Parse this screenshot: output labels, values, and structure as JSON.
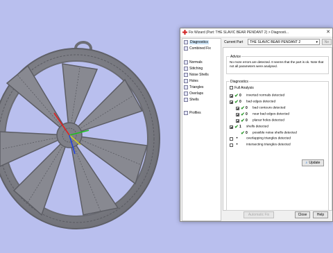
{
  "window": {
    "title": "Fix Wizard (Part: THE SLAVIC BEAR PENDANT 2) > Diagnosti...",
    "close_glyph": "✕"
  },
  "nav": {
    "items": [
      {
        "label": "Diagnostics",
        "icon": "magnifier-icon"
      },
      {
        "label": "Combined Fix",
        "icon": "combined-fix-icon"
      },
      {
        "label": "Normals",
        "icon": "normals-icon"
      },
      {
        "label": "Stitching",
        "icon": "stitching-icon"
      },
      {
        "label": "Noise Shells",
        "icon": "noise-shells-icon"
      },
      {
        "label": "Holes",
        "icon": "holes-icon"
      },
      {
        "label": "Triangles",
        "icon": "triangles-icon"
      },
      {
        "label": "Overlaps",
        "icon": "overlaps-icon"
      },
      {
        "label": "Shells",
        "icon": "shells-icon"
      },
      {
        "label": "Profiles",
        "icon": "profiles-icon"
      }
    ]
  },
  "part": {
    "label": "Current Part",
    "value": "THE SLAVIC BEAR PENDANT 2",
    "next_label": "Ne"
  },
  "advice": {
    "title": "Advice",
    "text": "No more errors are detected. It seems that the part is ok. Note that not all parameters were analysed."
  },
  "diagnostics": {
    "title": "Diagnostics",
    "full_analysis_label": "Full Analysis",
    "rows": [
      {
        "checked": true,
        "status": "ok",
        "count": "0",
        "label": "inverted normals detected"
      },
      {
        "checked": true,
        "status": "ok",
        "count": "0",
        "label": "bad edges detected"
      },
      {
        "checked": true,
        "status": "ok",
        "count": "0",
        "label": "bad contours detected"
      },
      {
        "checked": true,
        "status": "ok",
        "count": "0",
        "label": "near bad edges detected"
      },
      {
        "checked": true,
        "status": "ok",
        "count": "0",
        "label": "planar holes detected"
      },
      {
        "checked": true,
        "status": "ok",
        "count": "1",
        "label": "shells detected"
      },
      {
        "checked": false,
        "status": "ok",
        "count": "0",
        "label": "possible noise shells detected"
      },
      {
        "checked": false,
        "status": "none",
        "count": "",
        "label": "overlapping triangles detected"
      },
      {
        "checked": false,
        "status": "none",
        "count": "",
        "label": "intersecting triangles detected"
      }
    ],
    "update_label": "Update"
  },
  "footer": {
    "repair_label": "Automatic Fix",
    "close_label": "Close",
    "help_label": "Help"
  },
  "colors": {
    "viewport_bg": "#b9bfee",
    "model_gray": "#8f9096",
    "ok_green": "#2e9a2e"
  }
}
